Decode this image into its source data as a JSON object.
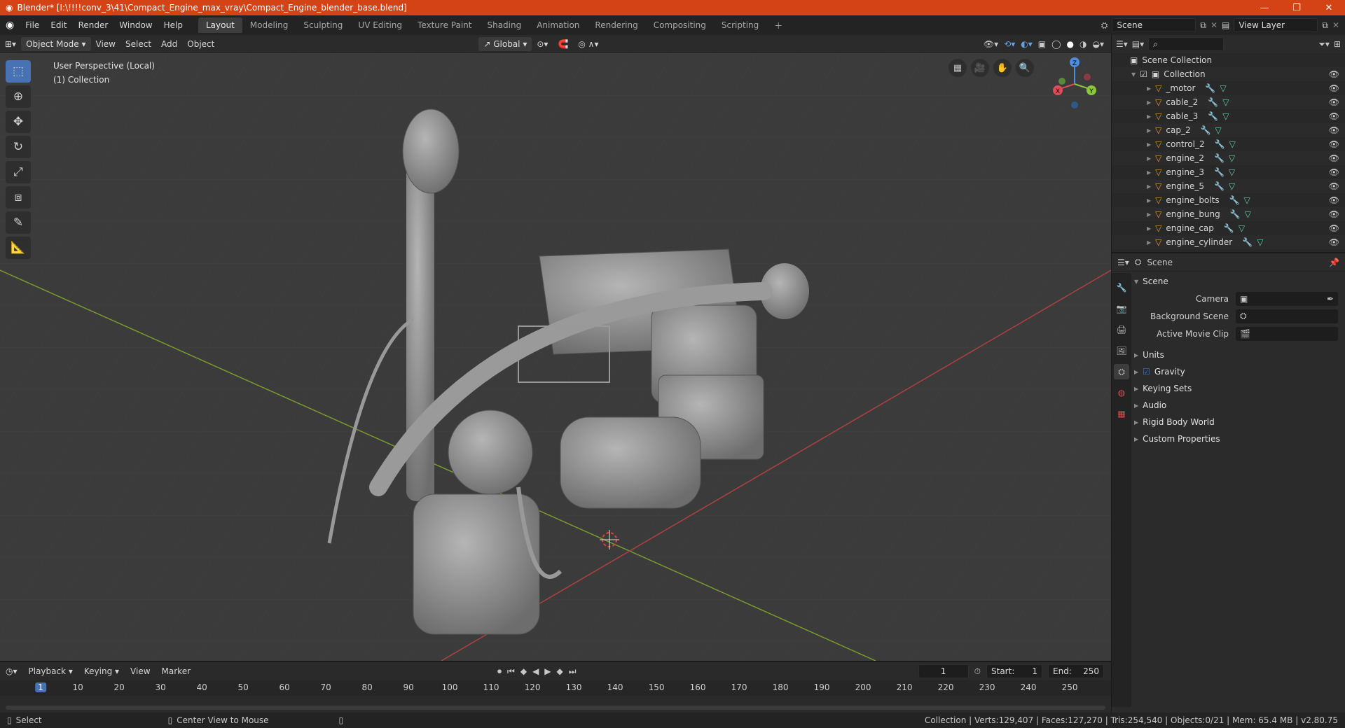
{
  "window": {
    "title": "Blender* [I:\\!!!!conv_3\\41\\Compact_Engine_max_vray\\Compact_Engine_blender_base.blend]"
  },
  "menu": [
    "File",
    "Edit",
    "Render",
    "Window",
    "Help"
  ],
  "workspaces": [
    "Layout",
    "Modeling",
    "Sculpting",
    "UV Editing",
    "Texture Paint",
    "Shading",
    "Animation",
    "Rendering",
    "Compositing",
    "Scripting"
  ],
  "active_workspace": "Layout",
  "scene_field": "Scene",
  "view_layer_field": "View Layer",
  "viewport_header": {
    "mode": "Object Mode",
    "view": "View",
    "select": "Select",
    "add": "Add",
    "object": "Object",
    "orientation": "Global"
  },
  "viewport": {
    "perspective": "User Perspective (Local)",
    "collection": "(1) Collection"
  },
  "gizmo": {
    "z": "Z",
    "x": "X",
    "y": "Y"
  },
  "outliner": {
    "root": "Scene Collection",
    "collection": "Collection",
    "items": [
      "_motor",
      "cable_2",
      "cable_3",
      "cap_2",
      "control_2",
      "engine_2",
      "engine_3",
      "engine_5",
      "engine_bolts",
      "engine_bung",
      "engine_cap",
      "engine_cylinder"
    ]
  },
  "properties": {
    "header": "Scene",
    "section": "Scene",
    "fields": [
      {
        "label": "Camera"
      },
      {
        "label": "Background Scene"
      },
      {
        "label": "Active Movie Clip"
      }
    ],
    "panels": [
      "Units",
      "Gravity",
      "Keying Sets",
      "Audio",
      "Rigid Body World",
      "Custom Properties"
    ]
  },
  "timeline": {
    "menus": [
      "Playback",
      "Keying",
      "View",
      "Marker"
    ],
    "current_frame": "1",
    "start_label": "Start:",
    "start": "1",
    "end_label": "End:",
    "end": "250",
    "ticks": [
      "1",
      "10",
      "20",
      "30",
      "40",
      "50",
      "60",
      "70",
      "80",
      "90",
      "100",
      "110",
      "120",
      "130",
      "140",
      "150",
      "160",
      "170",
      "180",
      "190",
      "200",
      "210",
      "220",
      "230",
      "240",
      "250"
    ]
  },
  "statusbar": {
    "left": "Select",
    "middle": "Center View to Mouse",
    "right": "Collection | Verts:129,407 | Faces:127,270 | Tris:254,540 | Objects:0/21 | Mem: 65.4 MB | v2.80.75"
  }
}
